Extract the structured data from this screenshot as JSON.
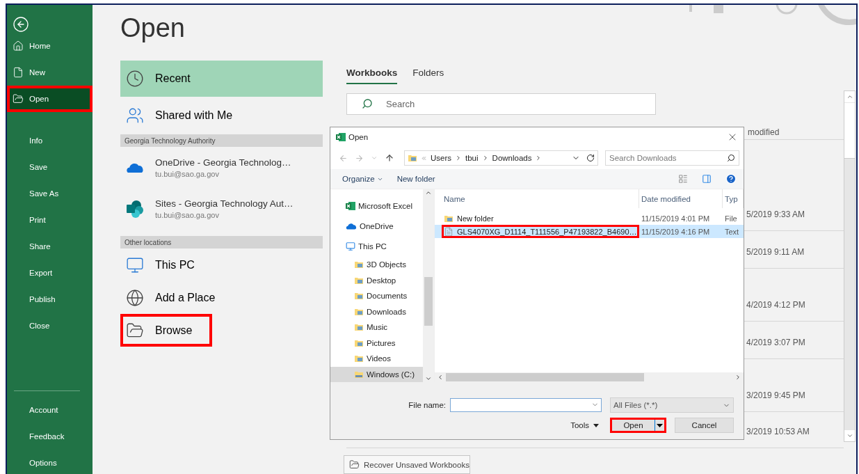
{
  "sidebar": {
    "items": [
      {
        "label": "Home",
        "kind": "home",
        "selected": false,
        "highlighted": false
      },
      {
        "label": "New",
        "kind": "new",
        "selected": false,
        "highlighted": false
      },
      {
        "label": "Open",
        "kind": "open",
        "selected": true,
        "highlighted": true
      },
      {
        "label": "Info",
        "kind": "plain",
        "selected": false,
        "highlighted": false
      },
      {
        "label": "Save",
        "kind": "plain",
        "selected": false,
        "highlighted": false
      },
      {
        "label": "Save As",
        "kind": "plain",
        "selected": false,
        "highlighted": false
      },
      {
        "label": "Print",
        "kind": "plain",
        "selected": false,
        "highlighted": false
      },
      {
        "label": "Share",
        "kind": "plain",
        "selected": false,
        "highlighted": false
      },
      {
        "label": "Export",
        "kind": "plain",
        "selected": false,
        "highlighted": false
      },
      {
        "label": "Publish",
        "kind": "plain",
        "selected": false,
        "highlighted": false
      },
      {
        "label": "Close",
        "kind": "plain",
        "selected": false,
        "highlighted": false
      }
    ],
    "footer_items": [
      {
        "label": "Account",
        "selected": false
      },
      {
        "label": "Feedback",
        "selected": false
      },
      {
        "label": "Options",
        "selected": false
      }
    ]
  },
  "title": "Open",
  "places": [
    {
      "kind": "recent",
      "label": "Recent",
      "selected": true,
      "highlighted": false
    },
    {
      "kind": "shared",
      "label": "Shared with Me",
      "selected": false,
      "highlighted": false
    },
    {
      "kind": "header",
      "label": "Georgia Technology Authority"
    },
    {
      "kind": "onedrive",
      "label": "OneDrive - Georgia Technolog…",
      "account": "tu.bui@sao.ga.gov",
      "selected": false,
      "highlighted": false
    },
    {
      "kind": "sites",
      "label": "Sites - Georgia Technology Aut…",
      "account": "tu.bui@sao.ga.gov",
      "selected": false,
      "highlighted": false
    },
    {
      "kind": "header",
      "label": "Other locations"
    },
    {
      "kind": "pc",
      "label": "This PC",
      "selected": false,
      "highlighted": false
    },
    {
      "kind": "add",
      "label": "Add a Place",
      "selected": false,
      "highlighted": false
    },
    {
      "kind": "browse",
      "label": "Browse",
      "selected": false,
      "highlighted": true
    }
  ],
  "tabs": [
    {
      "label": "Workbooks",
      "selected": true
    },
    {
      "label": "Folders",
      "selected": false
    }
  ],
  "search": {
    "placeholder": "Search"
  },
  "recent_list": {
    "column_header": "modified",
    "rows": [
      {
        "modified": "5/2019 9:33 AM"
      },
      {
        "modified": "5/2019 9:11 AM"
      },
      {
        "modified": "4/2019 4:12 PM"
      },
      {
        "modified": "4/2019 3:07 PM"
      },
      {
        "modified": "3/2019 9:45 PM"
      },
      {
        "modified": "3/2019 10:53 AM"
      }
    ]
  },
  "recover_button": "Recover Unsaved Workbooks",
  "dialog": {
    "title": "Open",
    "breadcrumb": [
      "Users",
      "tbui",
      "Downloads"
    ],
    "search": {
      "placeholder": "Search Downloads"
    },
    "toolbar": {
      "organize": "Organize",
      "new_folder": "New folder"
    },
    "nav": [
      {
        "label": "Microsoft Excel",
        "kind": "excel",
        "selected": false
      },
      {
        "label": "OneDrive",
        "kind": "onedrive",
        "selected": false
      },
      {
        "label": "This PC",
        "kind": "pc",
        "selected": false,
        "children": [
          {
            "label": "3D Objects",
            "kind": "folder",
            "selected": false
          },
          {
            "label": "Desktop",
            "kind": "folder",
            "selected": false
          },
          {
            "label": "Documents",
            "kind": "folder",
            "selected": false
          },
          {
            "label": "Downloads",
            "kind": "folder",
            "selected": false
          },
          {
            "label": "Music",
            "kind": "folder",
            "selected": false
          },
          {
            "label": "Pictures",
            "kind": "folder",
            "selected": false
          },
          {
            "label": "Videos",
            "kind": "folder",
            "selected": false
          },
          {
            "label": "Windows (C:)",
            "kind": "drive",
            "selected": true
          }
        ]
      }
    ],
    "columns": [
      "Name",
      "Date modified",
      "Typ"
    ],
    "files": [
      {
        "kind": "folder",
        "name": "New folder",
        "modified": "11/15/2019 4:01 PM",
        "type": "File",
        "selected": false,
        "highlighted": false
      },
      {
        "kind": "file",
        "name": "GLS4070XG_D1114_T111556_P47193822_B4690…",
        "modified": "11/15/2019 4:16 PM",
        "type": "Text",
        "selected": true,
        "highlighted": true
      }
    ],
    "file_name_label": "File name:",
    "file_type": "All Files (*.*)",
    "tools": "Tools",
    "open_button": {
      "label": "Open",
      "highlighted": true
    },
    "cancel_button": "Cancel"
  }
}
